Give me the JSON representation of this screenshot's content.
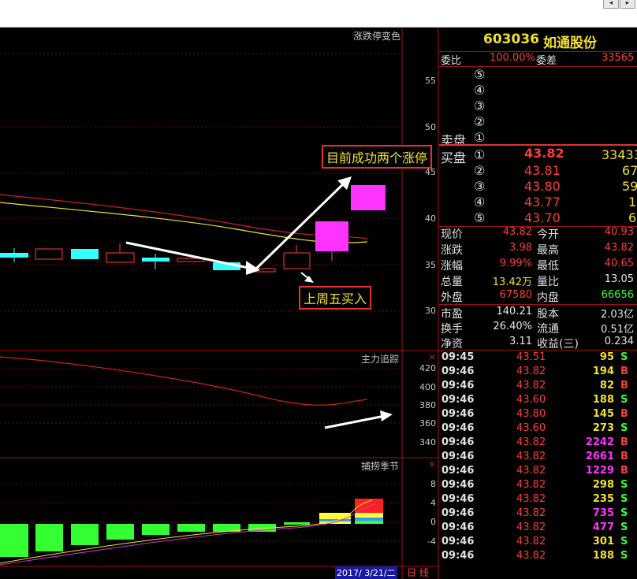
{
  "window": {
    "scroll_left_label": "◂",
    "scroll_right_label": "▸"
  },
  "chart_panels": {
    "main_title": "涨跌停变色",
    "main_yticks": [
      "55",
      "50",
      "45",
      "40",
      "35",
      "30"
    ],
    "indicator_title": "主力追踪",
    "indicator_yticks": [
      "420",
      "400",
      "380",
      "360",
      "340"
    ],
    "bottom_title": "捕捞季节",
    "bottom_yticks": [
      "8",
      "4",
      "0",
      "-4"
    ],
    "date_label": "2017/ 3/21/二",
    "period_label": "日 线",
    "close_label": "×"
  },
  "annotations": {
    "top": "目前成功两个涨停",
    "bottom": "上周五买入"
  },
  "quote": {
    "code": "603036",
    "name": "如通股份",
    "weibi_label": "委比",
    "weibi_value": "100.00%",
    "weicha_label": "委差",
    "weicha_value": "33565",
    "sell_label": "卖盘",
    "buy_label": "买盘",
    "sell_levels": [
      "⑤",
      "④",
      "③",
      "②",
      "①"
    ],
    "buy_levels": [
      {
        "idx": "①",
        "price": "43.82",
        "vol": "33433"
      },
      {
        "idx": "②",
        "price": "43.81",
        "vol": "67"
      },
      {
        "idx": "③",
        "price": "43.80",
        "vol": "59"
      },
      {
        "idx": "④",
        "price": "43.77",
        "vol": "1"
      },
      {
        "idx": "⑤",
        "price": "43.70",
        "vol": "6"
      }
    ],
    "stats": [
      {
        "l1": "现价",
        "v1": "43.82",
        "c1": "red",
        "l2": "今开",
        "v2": "40.93",
        "c2": "red"
      },
      {
        "l1": "涨跌",
        "v1": "3.98",
        "c1": "red",
        "l2": "最高",
        "v2": "43.82",
        "c2": "red"
      },
      {
        "l1": "涨幅",
        "v1": "9.99%",
        "c1": "red",
        "l2": "最低",
        "v2": "40.65",
        "c2": "red"
      },
      {
        "l1": "总量",
        "v1": "13.42万",
        "c1": "yellow",
        "l2": "量比",
        "v2": "13.05",
        "c2": "white"
      },
      {
        "l1": "外盘",
        "v1": "67580",
        "c1": "red",
        "l2": "内盘",
        "v2": "66656",
        "c2": "green"
      }
    ],
    "fundamentals": [
      {
        "l1": "市盈",
        "v1": "140.21",
        "l2": "股本",
        "v2": "2.03亿"
      },
      {
        "l1": "换手",
        "v1": "26.40%",
        "l2": "流通",
        "v2": "0.51亿"
      },
      {
        "l1": "净资",
        "v1": "3.11",
        "l2": "收益(三)",
        "v2": "0.234"
      }
    ],
    "ticks": [
      {
        "time": "09:45",
        "price": "43.51",
        "vol": "95",
        "side": "S",
        "vc": "yellow"
      },
      {
        "time": "09:46",
        "price": "43.82",
        "vol": "194",
        "side": "B",
        "vc": "yellow"
      },
      {
        "time": "09:46",
        "price": "43.82",
        "vol": "82",
        "side": "B",
        "vc": "yellow"
      },
      {
        "time": "09:46",
        "price": "43.60",
        "vol": "188",
        "side": "S",
        "vc": "yellow"
      },
      {
        "time": "09:46",
        "price": "43.80",
        "vol": "145",
        "side": "B",
        "vc": "yellow"
      },
      {
        "time": "09:46",
        "price": "43.60",
        "vol": "273",
        "side": "S",
        "vc": "yellow"
      },
      {
        "time": "09:46",
        "price": "43.82",
        "vol": "2242",
        "side": "B",
        "vc": "magenta"
      },
      {
        "time": "09:46",
        "price": "43.82",
        "vol": "2661",
        "side": "B",
        "vc": "magenta"
      },
      {
        "time": "09:46",
        "price": "43.82",
        "vol": "1229",
        "side": "B",
        "vc": "magenta"
      },
      {
        "time": "09:46",
        "price": "43.82",
        "vol": "298",
        "side": "S",
        "vc": "yellow"
      },
      {
        "time": "09:46",
        "price": "43.82",
        "vol": "235",
        "side": "S",
        "vc": "yellow"
      },
      {
        "time": "09:46",
        "price": "43.82",
        "vol": "735",
        "side": "S",
        "vc": "magenta"
      },
      {
        "time": "09:46",
        "price": "43.82",
        "vol": "477",
        "side": "S",
        "vc": "magenta"
      },
      {
        "time": "09:46",
        "price": "43.82",
        "vol": "301",
        "side": "S",
        "vc": "yellow"
      },
      {
        "time": "09:46",
        "price": "43.82",
        "vol": "188",
        "side": "S",
        "vc": "yellow"
      }
    ]
  },
  "colors": {
    "up": "#ff33ff",
    "down": "#33ffff",
    "red": "#ff3b3b",
    "yellow": "#f0e030",
    "green": "#33ff33",
    "grid": "#a01010"
  }
}
